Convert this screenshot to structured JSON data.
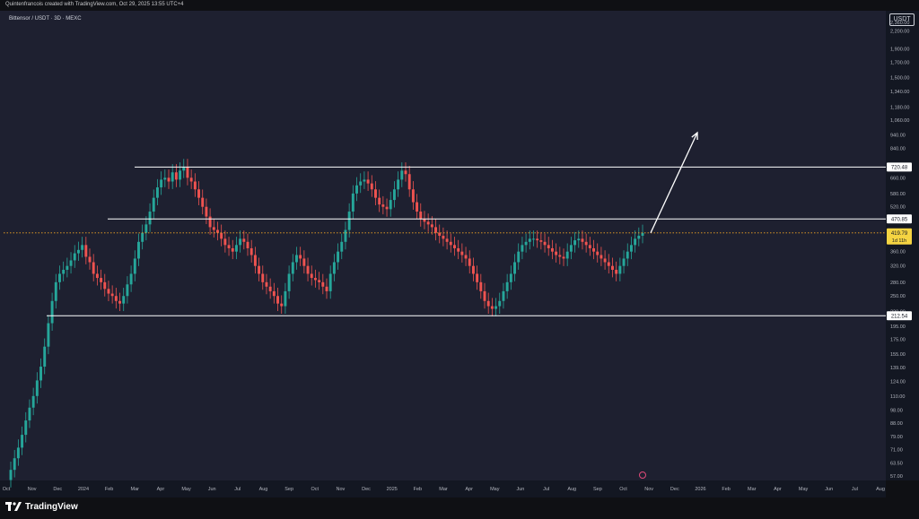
{
  "header": {
    "caption": "Quintenfrancois created with TradingView.com, Oct 29, 2025 13:55 UTC+4",
    "title": "Bittensor / USDT · 3D · MEXC",
    "currency": "USDT"
  },
  "footer": {
    "brand": "TradingView"
  },
  "colors": {
    "background": "#1e2030",
    "up": "#26a69a",
    "down": "#ef5350",
    "level_line": "#ffffff",
    "current_price": "#f5d442"
  },
  "chart_data": {
    "type": "candlestick",
    "title": "Bittensor / USDT · 3D · MEXC",
    "scale": "log",
    "ylim": [
      55,
      2600
    ],
    "y_ticks": [
      "2,360.00",
      "2,200.00",
      "1,900.00",
      "1,700.00",
      "1,500.00",
      "1,340.00",
      "1,180.00",
      "1,060.00",
      "940.00",
      "840.00",
      "660.00",
      "580.00",
      "520.00",
      "400.00",
      "360.00",
      "320.00",
      "280.00",
      "250.00",
      "220.00",
      "195.00",
      "175.00",
      "155.00",
      "139.00",
      "124.00",
      "110.00",
      "98.00",
      "88.00",
      "79.00",
      "71.00",
      "63.50",
      "57.00"
    ],
    "x_ticks": [
      "Oct",
      "Nov",
      "Dec",
      "2024",
      "Feb",
      "Mar",
      "Apr",
      "May",
      "Jun",
      "Jul",
      "Aug",
      "Sep",
      "Oct",
      "Nov",
      "Dec",
      "2025",
      "Feb",
      "Mar",
      "Apr",
      "May",
      "Jun",
      "Jul",
      "Aug",
      "Sep",
      "Oct",
      "Nov",
      "Dec",
      "2026",
      "Feb",
      "Mar",
      "Apr",
      "May",
      "Jun",
      "Jul",
      "Aug"
    ],
    "levels": [
      {
        "label": "720.48",
        "value": 720.48
      },
      {
        "label": "470.85",
        "value": 470.85
      },
      {
        "label": "212.54",
        "value": 212.54
      }
    ],
    "current_price": {
      "label": "419.79",
      "value": 419.79,
      "countdown": "1d 11h"
    },
    "closes": [
      60,
      66,
      72,
      80,
      90,
      100,
      110,
      125,
      140,
      165,
      200,
      240,
      280,
      300,
      310,
      320,
      335,
      355,
      365,
      380,
      345,
      330,
      300,
      290,
      280,
      265,
      255,
      250,
      240,
      235,
      250,
      275,
      300,
      340,
      390,
      420,
      450,
      500,
      560,
      610,
      650,
      660,
      640,
      690,
      650,
      700,
      720,
      660,
      640,
      600,
      560,
      520,
      480,
      440,
      430,
      420,
      400,
      380,
      370,
      360,
      380,
      400,
      390,
      370,
      350,
      320,
      300,
      280,
      270,
      260,
      250,
      235,
      230,
      260,
      300,
      330,
      350,
      340,
      320,
      300,
      290,
      285,
      280,
      270,
      260,
      300,
      330,
      360,
      390,
      430,
      500,
      580,
      620,
      640,
      650,
      630,
      600,
      560,
      530,
      520,
      510,
      550,
      600,
      650,
      700,
      680,
      600,
      540,
      500,
      470,
      460,
      450,
      440,
      420,
      410,
      400,
      390,
      380,
      370,
      360,
      350,
      340,
      320,
      300,
      280,
      260,
      240,
      230,
      225,
      230,
      240,
      260,
      280,
      300,
      330,
      360,
      380,
      390,
      400,
      400,
      395,
      390,
      380,
      370,
      360,
      350,
      345,
      340,
      360,
      380,
      395,
      400,
      390,
      380,
      370,
      360,
      350,
      340,
      330,
      320,
      310,
      300,
      320,
      340,
      360,
      380,
      400,
      410,
      419.79
    ]
  }
}
